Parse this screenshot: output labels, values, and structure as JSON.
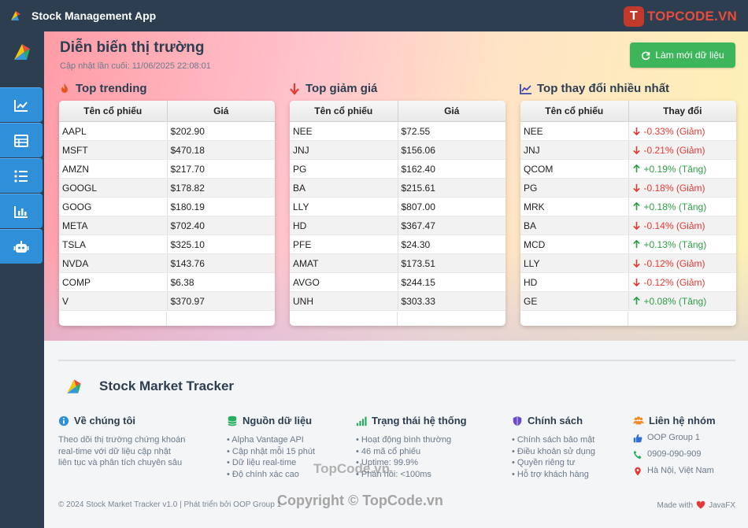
{
  "window": {
    "title": "Stock Management App"
  },
  "watermark": {
    "logo_text": "TOPCODE.VN",
    "center": "TopCode.vn",
    "bottom": "Copyright © TopCode.vn"
  },
  "header": {
    "title": "Diễn biến thị trường",
    "updated": "Cập nhật lần cuối: 11/06/2025 22:08:01",
    "refresh_label": "Làm mới dữ liệu"
  },
  "sidebar": {
    "items": [
      {
        "icon": "chart-line-icon"
      },
      {
        "icon": "table-icon"
      },
      {
        "icon": "list-icon"
      },
      {
        "icon": "bar-chart-icon"
      },
      {
        "icon": "robot-icon"
      }
    ]
  },
  "trending": {
    "title": "Top trending",
    "col1": "Tên cổ phiếu",
    "col2": "Giá",
    "rows": [
      [
        "AAPL",
        "$202.90"
      ],
      [
        "MSFT",
        "$470.18"
      ],
      [
        "AMZN",
        "$217.70"
      ],
      [
        "GOOGL",
        "$178.82"
      ],
      [
        "GOOG",
        "$180.19"
      ],
      [
        "META",
        "$702.40"
      ],
      [
        "TSLA",
        "$325.10"
      ],
      [
        "NVDA",
        "$143.76"
      ],
      [
        "COMP",
        "$6.38"
      ],
      [
        "V",
        "$370.97"
      ]
    ]
  },
  "losers": {
    "title": "Top giảm giá",
    "col1": "Tên cổ phiếu",
    "col2": "Giá",
    "rows": [
      [
        "NEE",
        "$72.55"
      ],
      [
        "JNJ",
        "$156.06"
      ],
      [
        "PG",
        "$162.40"
      ],
      [
        "BA",
        "$215.61"
      ],
      [
        "LLY",
        "$807.00"
      ],
      [
        "HD",
        "$367.47"
      ],
      [
        "PFE",
        "$24.30"
      ],
      [
        "AMAT",
        "$173.51"
      ],
      [
        "AVGO",
        "$244.15"
      ],
      [
        "UNH",
        "$303.33"
      ]
    ]
  },
  "movers": {
    "title": "Top thay đổi nhiều nhất",
    "col1": "Tên cổ phiếu",
    "col2": "Thay đổi",
    "rows": [
      [
        "NEE",
        "-0.33% (Giảm)",
        "down"
      ],
      [
        "JNJ",
        "-0.21% (Giảm)",
        "down"
      ],
      [
        "QCOM",
        "+0.19% (Tăng)",
        "up"
      ],
      [
        "PG",
        "-0.18% (Giảm)",
        "down"
      ],
      [
        "MRK",
        "+0.18% (Tăng)",
        "up"
      ],
      [
        "BA",
        "-0.14% (Giảm)",
        "down"
      ],
      [
        "MCD",
        "+0.13% (Tăng)",
        "up"
      ],
      [
        "LLY",
        "-0.12% (Giảm)",
        "down"
      ],
      [
        "HD",
        "-0.12% (Giảm)",
        "down"
      ],
      [
        "GE",
        "+0.08% (Tăng)",
        "up"
      ]
    ]
  },
  "footer": {
    "brand": "Stock Market Tracker",
    "about": {
      "title": "Về chúng tôi",
      "lines": [
        "Theo dõi thị trường chứng khoán",
        "real-time với dữ liệu cập nhật",
        "liên tục và phân tích chuyên sâu"
      ]
    },
    "sources": {
      "title": "Nguồn dữ liệu",
      "items": [
        "• Alpha Vantage API",
        "• Cập nhật mỗi 15 phút",
        "• Dữ liệu real-time",
        "• Độ chính xác cao"
      ]
    },
    "status": {
      "title": "Trạng thái hệ thống",
      "items": [
        "• Hoạt động bình thường",
        "• 46 mã cổ phiếu",
        "• Uptime: 99.9%",
        "• Phản hồi: <100ms"
      ]
    },
    "policy": {
      "title": "Chính sách",
      "items": [
        "• Chính sách bảo mật",
        "• Điều khoản sử dụng",
        "• Quyền riêng tư",
        "• Hỗ trợ khách hàng"
      ]
    },
    "contact": {
      "title": "Liên hệ nhóm",
      "group": "OOP Group 1",
      "phone": "0909-090-909",
      "address": "Hà Nội, Việt Nam"
    },
    "copyright": "© 2024 Stock Market Tracker v1.0 | Phát triển bởi OOP Group 1",
    "made_with": "Made with",
    "made_with_tech": "JavaFX"
  },
  "colors": {
    "accent": "#2f8fd8",
    "refresh": "#3cb55b",
    "down": "#e53935",
    "up": "#2e9e44"
  }
}
